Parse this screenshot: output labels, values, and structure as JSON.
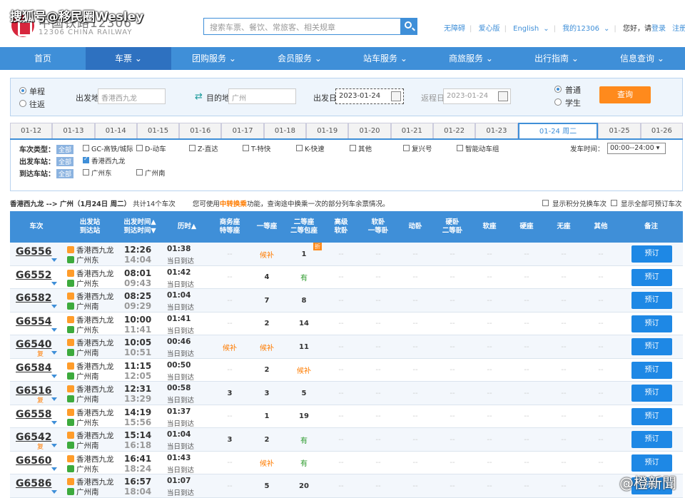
{
  "watermark_top": "搜狐号@移民圈Wesley",
  "watermark_bottom": "@橙新聞",
  "header": {
    "logo_cn": "中国铁路12306",
    "logo_en": "12306 CHINA RAILWAY",
    "search_placeholder": "搜索车票、餐饮、常旅客、相关规章",
    "links": [
      "无障碍",
      "爱心版",
      "English",
      "我的12306",
      "您好，请",
      "登录",
      "注册"
    ]
  },
  "nav": [
    "首页",
    "车票",
    "团购服务",
    "会员服务",
    "站车服务",
    "商旅服务",
    "出行指南",
    "信息查询"
  ],
  "search": {
    "trip_types": [
      "单程",
      "往返"
    ],
    "from_label": "出发地",
    "from_value": "香港西九龙",
    "to_label": "目的地",
    "to_value": "广州",
    "depart_label": "出发日",
    "depart_value": "2023-01-24",
    "return_label": "返程日",
    "return_value": "2023-01-24",
    "passenger_types": [
      "普通",
      "学生"
    ],
    "query_button": "查询"
  },
  "date_tabs": [
    "01-12",
    "01-13",
    "01-14",
    "01-15",
    "01-16",
    "01-17",
    "01-18",
    "01-19",
    "01-20",
    "01-21",
    "01-22",
    "01-23",
    "01-24 周二",
    "01-25",
    "01-26"
  ],
  "filters": {
    "train_type_label": "车次类型：",
    "all_label": "全部",
    "train_types": [
      "GC-高铁/城际",
      "D-动车",
      "Z-直达",
      "T-特快",
      "K-快速",
      "其他",
      "复兴号",
      "智能动车组"
    ],
    "depart_station_label": "出发车站：",
    "depart_stations": [
      "香港西九龙"
    ],
    "arrive_station_label": "到达车站：",
    "arrive_stations": [
      "广州东",
      "广州南"
    ],
    "time_label": "发车时间：",
    "time_value": "00:00--24:00"
  },
  "summary": {
    "route": "香港西九龙 --> 广州（1月24日 周二）",
    "count": "共计14个车次",
    "note_pre": "您可使用",
    "note_hl": "中转换乘",
    "note_post": "功能，查询途中换乘一次的部分列车余票情况。",
    "opt1": "显示积分兑换车次",
    "opt2": "显示全部可预订车次"
  },
  "table_headers": [
    [
      "车次"
    ],
    [
      "出发站",
      "到达站"
    ],
    [
      "出发时间▲",
      "到达时间▼"
    ],
    [
      "历时▲"
    ],
    [
      "商务座",
      "特等座"
    ],
    [
      "一等座"
    ],
    [
      "二等座",
      "二等包座"
    ],
    [
      "高级",
      "软卧"
    ],
    [
      "软卧",
      "一等卧"
    ],
    [
      "动卧"
    ],
    [
      "硬卧",
      "二等卧"
    ],
    [
      "软座"
    ],
    [
      "硬座"
    ],
    [
      "无座"
    ],
    [
      "其他"
    ],
    [
      "备注"
    ]
  ],
  "book_label": "预订",
  "rows": [
    {
      "no": "G6556",
      "fu": "",
      "from": "香港西九龙",
      "to": "广州东",
      "dep": "12:26",
      "arr": "14:04",
      "dur": "01:38",
      "arrday": "当日到达",
      "seats": [
        "--",
        "候补",
        "1",
        "--",
        "--",
        "--",
        "--",
        "--",
        "--",
        "--",
        "--"
      ],
      "badge": "折"
    },
    {
      "no": "G6552",
      "fu": "",
      "from": "香港西九龙",
      "to": "广州东",
      "dep": "08:01",
      "arr": "09:43",
      "dur": "01:42",
      "arrday": "当日到达",
      "seats": [
        "--",
        "4",
        "有",
        "--",
        "--",
        "--",
        "--",
        "--",
        "--",
        "--",
        "--"
      ],
      "badge": ""
    },
    {
      "no": "G6582",
      "fu": "",
      "from": "香港西九龙",
      "to": "广州南",
      "dep": "08:25",
      "arr": "09:29",
      "dur": "01:04",
      "arrday": "当日到达",
      "seats": [
        "--",
        "7",
        "8",
        "--",
        "--",
        "--",
        "--",
        "--",
        "--",
        "--",
        "--"
      ],
      "badge": ""
    },
    {
      "no": "G6554",
      "fu": "",
      "from": "香港西九龙",
      "to": "广州东",
      "dep": "10:00",
      "arr": "11:41",
      "dur": "01:41",
      "arrday": "当日到达",
      "seats": [
        "--",
        "2",
        "14",
        "--",
        "--",
        "--",
        "--",
        "--",
        "--",
        "--",
        "--"
      ],
      "badge": ""
    },
    {
      "no": "G6540",
      "fu": "复",
      "from": "香港西九龙",
      "to": "广州南",
      "dep": "10:05",
      "arr": "10:51",
      "dur": "00:46",
      "arrday": "当日到达",
      "seats": [
        "候补",
        "候补",
        "11",
        "--",
        "--",
        "--",
        "--",
        "--",
        "--",
        "--",
        "--"
      ],
      "badge": ""
    },
    {
      "no": "G6584",
      "fu": "",
      "from": "香港西九龙",
      "to": "广州南",
      "dep": "11:15",
      "arr": "12:05",
      "dur": "00:50",
      "arrday": "当日到达",
      "seats": [
        "--",
        "2",
        "候补",
        "--",
        "--",
        "--",
        "--",
        "--",
        "--",
        "--",
        "--"
      ],
      "badge": ""
    },
    {
      "no": "G6516",
      "fu": "复",
      "from": "香港西九龙",
      "to": "广州南",
      "dep": "12:31",
      "arr": "13:29",
      "dur": "00:58",
      "arrday": "当日到达",
      "seats": [
        "3",
        "3",
        "5",
        "--",
        "--",
        "--",
        "--",
        "--",
        "--",
        "--",
        "--"
      ],
      "badge": ""
    },
    {
      "no": "G6558",
      "fu": "",
      "from": "香港西九龙",
      "to": "广州东",
      "dep": "14:19",
      "arr": "15:56",
      "dur": "01:37",
      "arrday": "当日到达",
      "seats": [
        "--",
        "1",
        "19",
        "--",
        "--",
        "--",
        "--",
        "--",
        "--",
        "--",
        "--"
      ],
      "badge": ""
    },
    {
      "no": "G6542",
      "fu": "复",
      "from": "香港西九龙",
      "to": "广州南",
      "dep": "15:14",
      "arr": "16:18",
      "dur": "01:04",
      "arrday": "当日到达",
      "seats": [
        "3",
        "2",
        "有",
        "--",
        "--",
        "--",
        "--",
        "--",
        "--",
        "--",
        "--"
      ],
      "badge": ""
    },
    {
      "no": "G6560",
      "fu": "",
      "from": "香港西九龙",
      "to": "广州东",
      "dep": "16:41",
      "arr": "18:24",
      "dur": "01:43",
      "arrday": "当日到达",
      "seats": [
        "--",
        "候补",
        "有",
        "--",
        "--",
        "--",
        "--",
        "--",
        "--",
        "--",
        "--"
      ],
      "badge": ""
    },
    {
      "no": "G6586",
      "fu": "",
      "from": "香港西九龙",
      "to": "广州南",
      "dep": "16:57",
      "arr": "18:04",
      "dur": "01:07",
      "arrday": "当日到达",
      "seats": [
        "--",
        "5",
        "20",
        "--",
        "--",
        "--",
        "--",
        "--",
        "--",
        "--",
        "--"
      ],
      "badge": ""
    }
  ]
}
